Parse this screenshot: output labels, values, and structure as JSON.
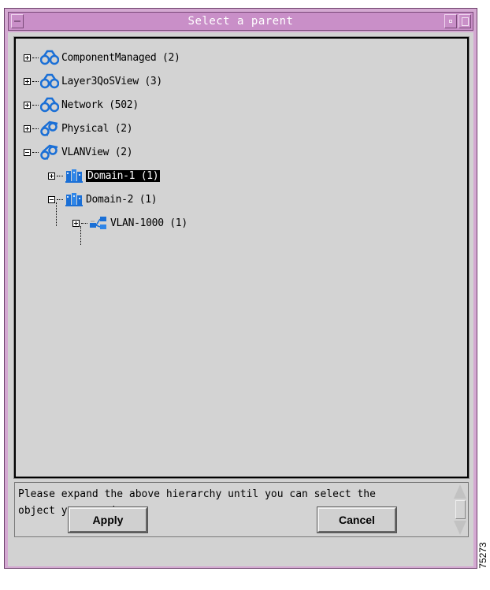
{
  "window": {
    "title": "Select a parent"
  },
  "tree": {
    "items": [
      {
        "label": "ComponentManaged (2)",
        "icon": "binoculars-icon",
        "expanded": false,
        "level": 0
      },
      {
        "label": "Layer3QoSView (3)",
        "icon": "binoculars-icon",
        "expanded": false,
        "level": 0
      },
      {
        "label": "Network (502)",
        "icon": "binoculars-icon",
        "expanded": false,
        "level": 0
      },
      {
        "label": "Physical (2)",
        "icon": "physical-view-icon",
        "expanded": false,
        "level": 0
      },
      {
        "label": "VLANView (2)",
        "icon": "physical-view-icon",
        "expanded": true,
        "level": 0
      },
      {
        "label": "Domain-1 (1)",
        "icon": "domain-icon",
        "expanded": false,
        "level": 1,
        "selected": true
      },
      {
        "label": "Domain-2 (1)",
        "icon": "domain-icon",
        "expanded": true,
        "level": 1
      },
      {
        "label": "VLAN-1000 (1)",
        "icon": "vlan-icon",
        "expanded": false,
        "level": 2
      }
    ]
  },
  "message": {
    "text": "Please expand the above hierarchy until you can select the\nobject you require."
  },
  "buttons": {
    "apply": "Apply",
    "cancel": "Cancel"
  },
  "figure_id": "75273",
  "colors": {
    "window_frame": "#d4a9d2",
    "titlebar": "#c98fc8",
    "panel": "#d3d3d3",
    "icon_blue": "#1a6fd6"
  }
}
